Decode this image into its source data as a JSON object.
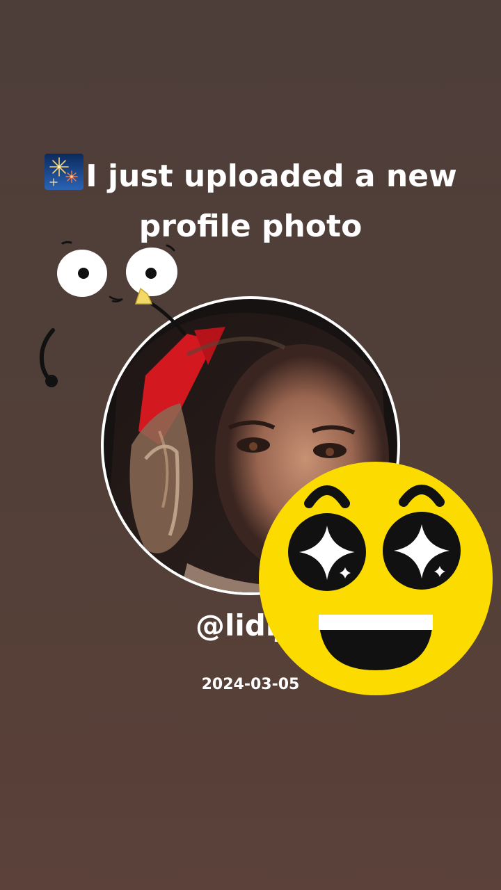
{
  "post": {
    "headline": "I just uploaded a new profile photo",
    "headline_icon": "fireworks-icon",
    "username": "@lidija",
    "date": "2024-03-05"
  },
  "stickers": {
    "doodle": "cartoon-eyes-doodle",
    "emoji": "star-struck-emoji"
  },
  "colors": {
    "background": "#513f38",
    "text": "#ffffff",
    "avatar_ring": "#ffffff",
    "emoji_yellow": "#fcdc00"
  }
}
